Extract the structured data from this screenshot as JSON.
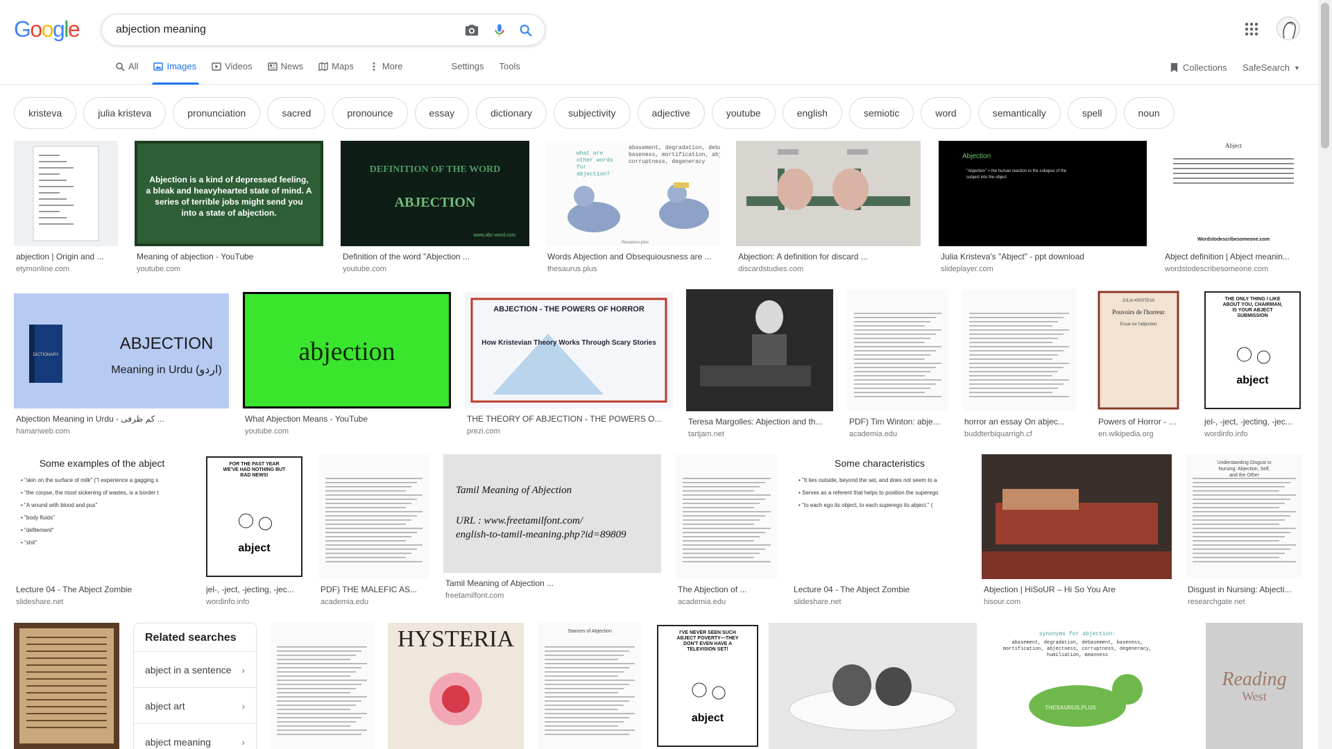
{
  "logo": {
    "text": "Google",
    "colors": [
      "#4285f4",
      "#ea4335",
      "#fbbc05",
      "#4285f4",
      "#34a853",
      "#ea4335"
    ]
  },
  "search": {
    "query": "abjection meaning"
  },
  "tabs": [
    {
      "label": "All",
      "icon": "search-icon",
      "active": false
    },
    {
      "label": "Images",
      "icon": "image-icon",
      "active": true
    },
    {
      "label": "Videos",
      "icon": "video-icon",
      "active": false
    },
    {
      "label": "News",
      "icon": "news-icon",
      "active": false
    },
    {
      "label": "Maps",
      "icon": "map-icon",
      "active": false
    },
    {
      "label": "More",
      "icon": "more-vert-icon",
      "active": false
    }
  ],
  "tools": {
    "settings": "Settings",
    "tools": "Tools"
  },
  "header_right": {
    "collections": "Collections",
    "safesearch": "SafeSearch"
  },
  "chips": [
    "kristeva",
    "julia kristeva",
    "pronunciation",
    "sacred",
    "pronounce",
    "essay",
    "dictionary",
    "subjectivity",
    "adjective",
    "youtube",
    "english",
    "semiotic",
    "word",
    "semantically",
    "spell",
    "noun"
  ],
  "results": [
    {
      "title": "abjection | Origin and ...",
      "source": "etymonline.com",
      "thumb": "etym"
    },
    {
      "title": "Meaning of abjection - YouTube",
      "source": "youtube.com",
      "thumb": "chalk",
      "text": "Abjection is a kind of depressed feeling, a bleak and heavyhearted state of mind. A series of terrible jobs might send you into a state of abjection."
    },
    {
      "title": "Definition of the word \"Abjection ...",
      "source": "youtube.com",
      "thumb": "defword",
      "text": "DEFINITION OF THE WORD",
      "text2": "ABJECTION",
      "text3": "www.abc-word.com"
    },
    {
      "title": "Words Abjection and Obsequiousness are ...",
      "source": "thesaurus.plus",
      "thumb": "pigeons",
      "text": "abasement, degradation, debasement, baseness, mortification, abjectness, corruptness, degeneracy",
      "text2": "what are other words for abjection?",
      "text3": "thesaurus.plus"
    },
    {
      "title": "Abjection: A definition for discard ...",
      "source": "discardstudies.com",
      "thumb": "faucets"
    },
    {
      "title": "Julia Kristeva's \"Abject\" - ppt download",
      "source": "slideplayer.com",
      "thumb": "blackslide",
      "text": "Abjection",
      "text2": "\"Abjection\" = the human reaction to the collapse of the subject into the object"
    },
    {
      "title": "Abject definition | Abject meanin...",
      "source": "wordstodescribesomeone.com",
      "thumb": "worddef",
      "text": "Abject",
      "text2": "Wordstodescribesomeone.com"
    },
    {
      "title": "Abjection Meaning in Urdu - کم ظرفی ...",
      "source": "hamariweb.com",
      "thumb": "urdu",
      "text": "ABJECTION",
      "text2": "Meaning in Urdu (اردو)",
      "text3": "DICTIONARY"
    },
    {
      "title": "What Abjection Means - YouTube",
      "source": "youtube.com",
      "thumb": "green",
      "text": "abjection"
    },
    {
      "title": "THE THEORY OF ABJECTION - THE POWERS O...",
      "source": "prezi.com",
      "thumb": "prezi",
      "text": "ABJECTION - THE POWERS OF HORROR",
      "text2": "How Kristevian Theory Works Through Scary Stories"
    },
    {
      "title": "Teresa Margolles: Abjection and th...",
      "source": "tartjam.net",
      "thumb": "photo_bw"
    },
    {
      "title": "PDF) Tim Winton: abje...",
      "source": "academia.edu",
      "thumb": "doc"
    },
    {
      "title": "horror an essay On abjec...",
      "source": "buddterbiquarrigh.cf",
      "thumb": "doc"
    },
    {
      "title": "Powers of Horror - Wi...",
      "source": "en.wikipedia.org",
      "thumb": "book",
      "text": "JULIA KRISTEVA",
      "text2": "Pouvoirs de l'horreur",
      "text3": "Essai sur l'abjection"
    },
    {
      "title": "jel-, -ject, -jecting, -jec...",
      "source": "wordinfo.info",
      "thumb": "cartoon",
      "text": "THE ONLY THING I LIKE ABOUT YOU, CHAIRMAN, IS YOUR ABJECT SUBMISSION",
      "text2": "abject"
    },
    {
      "title": "Lecture 04 - The Abject Zombie",
      "source": "slideshare.net",
      "thumb": "slide",
      "text": "Some examples of the abject",
      "lines": [
        "• \"skin on the surface of milk\" (\"I experience a gagging sensation\")",
        "• \"the corpse, the most sickening of wastes, is a border that has encroached upon everything.\"",
        "• \"A wound with blood and pus\"",
        "• \"body fluids\"",
        "• \"defilement\"",
        "• \"shit\""
      ]
    },
    {
      "title": "jel-, -ject, -jecting, -jec...",
      "source": "wordinfo.info",
      "thumb": "cartoon",
      "text": "FOR THE PAST YEAR WE'VE HAD NOTHING BUT BAD NEWS!",
      "text2": "abject"
    },
    {
      "title": "PDF) THE MALEFIC AS...",
      "source": "academia.edu",
      "thumb": "doc"
    },
    {
      "title": "Tamil Meaning of Abjection ...",
      "source": "freetamilfont.com",
      "thumb": "tamil",
      "text": "Tamil Meaning of Abjection",
      "text2": "URL : www.freetamilfont.com/",
      "text3": "english-to-tamil-meaning.php?id=89809"
    },
    {
      "title": "The Abjection of ...",
      "source": "academia.edu",
      "thumb": "doc"
    },
    {
      "title": "Lecture 04 - The Abject Zombie",
      "source": "slideshare.net",
      "thumb": "slide",
      "text": "Some characteristics",
      "lines": [
        "• \"It lies outside, beyond the set, and does not seem to agree to the latter's rules of the game.\" (2)",
        "• Serves as a referent that helps to position the superego by being an integral part of its definition through a binary opposition.",
        "• \"to each ego its object, to each superego its abject.\" (2)"
      ]
    },
    {
      "title": "Abjection | HiSoUR – Hi So You Are",
      "source": "hisour.com",
      "thumb": "couch"
    },
    {
      "title": "Disgust in Nursing: Abjecti...",
      "source": "researchgate.net",
      "thumb": "doc",
      "text": "Understanding Disgust in Nursing: Abjection, Self, and the Other"
    },
    {
      "thumb": "manuscript"
    },
    {
      "thumb": "doc"
    },
    {
      "thumb": "hysteria",
      "text": "HYSTERIA"
    },
    {
      "thumb": "doc",
      "text": "Stances of Abjection"
    },
    {
      "thumb": "cartoon",
      "text": "I'VE NEVER SEEN SUCH ABJECT POVERTY—THEY DON'T EVEN HAVE A TELEVISION SET!",
      "text2": "abject"
    },
    {
      "thumb": "plate"
    },
    {
      "thumb": "dino",
      "text": "synonyms for abjection:",
      "text2": "abasement, degradation, debasement, baseness, mortification, abjectness, corruptness, degeneracy, humiliation, meanness",
      "text3": "THESAURUS.PLUS"
    },
    {
      "thumb": "reading",
      "text": "Reading",
      "text2": "West"
    }
  ],
  "related": {
    "title": "Related searches",
    "items": [
      "abject in a sentence",
      "abject art",
      "abject meaning"
    ]
  }
}
